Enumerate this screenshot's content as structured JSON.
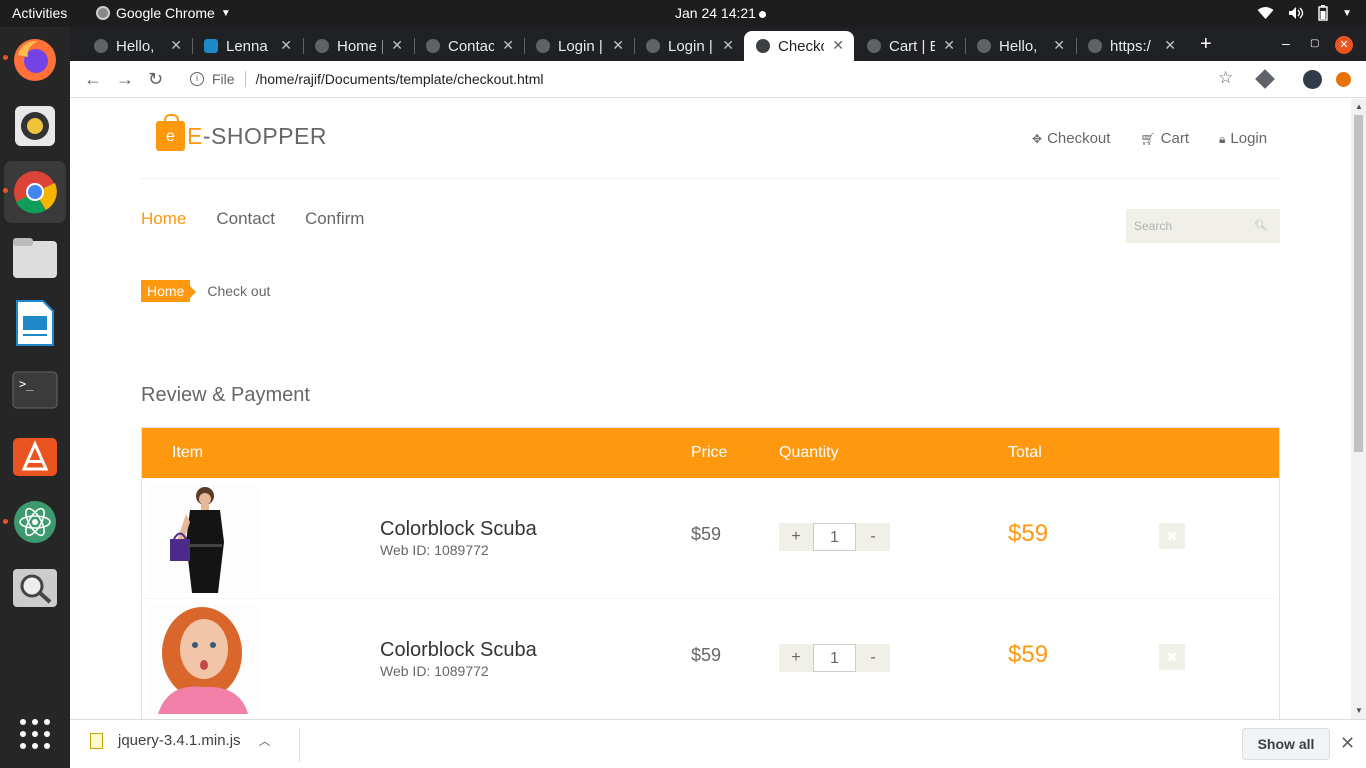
{
  "topbar": {
    "activities": "Activities",
    "app_name": "Google Chrome",
    "datetime": "Jan 24  14:21"
  },
  "tabs": [
    {
      "label": "Hello,",
      "active": false
    },
    {
      "label": "Lenna",
      "active": false
    },
    {
      "label": "Home |",
      "active": false
    },
    {
      "label": "Contac",
      "active": false
    },
    {
      "label": "Login |",
      "active": false
    },
    {
      "label": "Login |",
      "active": false
    },
    {
      "label": "Checko",
      "active": true
    },
    {
      "label": "Cart | E",
      "active": false
    },
    {
      "label": "Hello,",
      "active": false
    },
    {
      "label": "https:/",
      "active": false
    }
  ],
  "addressbar": {
    "scheme_label": "File",
    "url": "/home/rajif/Documents/template/checkout.html"
  },
  "site": {
    "logo_letter": "e",
    "brand_e": "E",
    "brand_rest": "-SHOPPER",
    "header_links": {
      "checkout": "Checkout",
      "cart": "Cart",
      "login": "Login"
    },
    "nav": {
      "home": "Home",
      "contact": "Contact",
      "confirm": "Confirm"
    },
    "search_placeholder": "Search",
    "breadcrumb": {
      "home": "Home",
      "current": "Check out"
    },
    "section_title": "Review & Payment",
    "table_headers": {
      "item": "Item",
      "price": "Price",
      "quantity": "Quantity",
      "total": "Total"
    },
    "cart_items": [
      {
        "name": "Colorblock Scuba",
        "web_id": "Web ID: 1089772",
        "price": "$59",
        "qty": "1",
        "total": "$59",
        "image": "woman-black-dress-shopping-bag"
      },
      {
        "name": "Colorblock Scuba",
        "web_id": "Web ID: 1089772",
        "price": "$59",
        "qty": "1",
        "total": "$59",
        "image": "red-haired-woman-pink-top"
      }
    ],
    "qty_plus": "+",
    "qty_minus": "-"
  },
  "downloads": {
    "filename": "jquery-3.4.1.min.js",
    "show_all": "Show all"
  },
  "colors": {
    "accent": "#fe980f",
    "text": "#696763",
    "ubuntu_orange": "#e95420"
  }
}
